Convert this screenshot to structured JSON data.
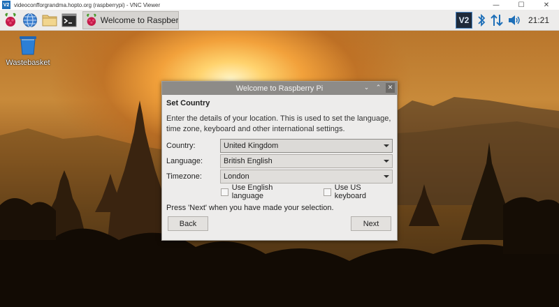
{
  "vnc": {
    "logo_text": "V2",
    "title": "videoconfforgrandma.hopto.org (raspberrypi) - VNC Viewer",
    "minimize_glyph": "—",
    "maximize_glyph": "☐",
    "close_glyph": "✕"
  },
  "taskbar": {
    "launchers": [
      "raspberry-menu-icon",
      "web-browser-icon",
      "file-manager-icon",
      "terminal-icon"
    ],
    "task_label": "Welcome to Raspberr...",
    "tray": {
      "vnc_icon_text": "V2",
      "clock": "21:21"
    },
    "colors": {
      "bluetooth": "#1e6fb8",
      "network": "#1e6fb8",
      "volume": "#1e6fb8"
    }
  },
  "desktop": {
    "wastebasket_label": "Wastebasket"
  },
  "dialog": {
    "title": "Welcome to Raspberry Pi",
    "controls": {
      "minimize": "⌄",
      "maximize": "⌃",
      "close": "✕"
    },
    "heading": "Set Country",
    "description": "Enter the details of your location. This is used to set the language, time zone, keyboard and other international settings.",
    "fields": {
      "country": {
        "label": "Country:",
        "value": "United Kingdom"
      },
      "language": {
        "label": "Language:",
        "value": "British English"
      },
      "timezone": {
        "label": "Timezone:",
        "value": "London"
      }
    },
    "checkboxes": {
      "english": "Use English language",
      "us_keyboard": "Use US keyboard"
    },
    "prompt": "Press 'Next' when you have made your selection.",
    "back_label": "Back",
    "next_label": "Next"
  }
}
